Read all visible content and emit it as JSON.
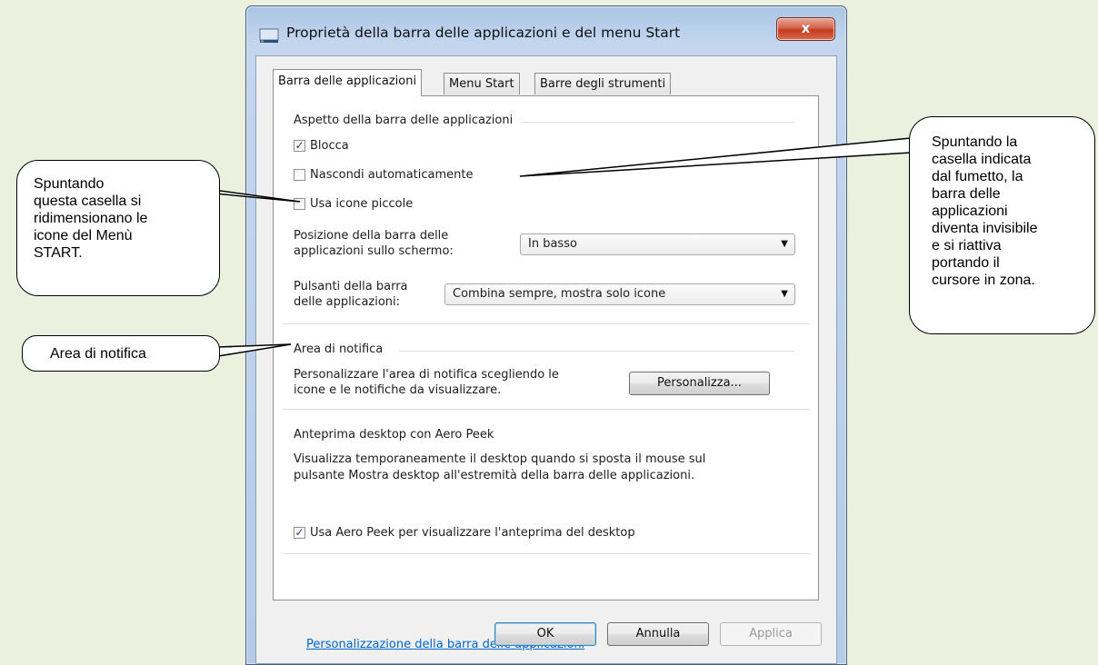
{
  "window": {
    "title": "Proprietà della barra delle applicazioni e del menu Start",
    "close_symbol": "x",
    "tabs": [
      {
        "label": "Barra delle applicazioni",
        "active": true
      },
      {
        "label": "Menu Start",
        "active": false
      },
      {
        "label": "Barre degli strumenti",
        "active": false
      }
    ]
  },
  "appearance": {
    "group_title": "Aspetto della barra delle applicazioni",
    "lock": {
      "label": "Blocca",
      "checked": true
    },
    "autohide": {
      "label": "Nascondi automaticamente",
      "checked": false
    },
    "small_icons": {
      "label": "Usa icone piccole",
      "checked": false
    },
    "position_label_1": "Posizione della barra delle",
    "position_label_2": "applicazioni sullo schermo:",
    "position_value": "In basso",
    "buttons_label_1": "Pulsanti della barra",
    "buttons_label_2": "delle applicazioni:",
    "buttons_value": "Combina sempre, mostra solo icone"
  },
  "notification": {
    "group_title": "Area di notifica",
    "text_1": "Personalizzare l'area di notifica scegliendo le",
    "text_2": "icone e le notifiche da visualizzare.",
    "button": "Personalizza..."
  },
  "aero_peek": {
    "group_title": "Anteprima desktop con Aero Peek",
    "text_1": "Visualizza temporaneamente il desktop quando si sposta il mouse sul",
    "text_2": "pulsante Mostra desktop all'estremità della barra delle applicazioni.",
    "checkbox": {
      "label": "Usa Aero Peek per visualizzare l'anteprima del desktop",
      "checked": true
    }
  },
  "link": "Personalizzazione della barra delle applicazioni",
  "footer": {
    "ok": "OK",
    "cancel": "Annulla",
    "apply": "Applica"
  },
  "check_mark": "✓",
  "dropdown_arrow": "▼",
  "callouts": {
    "small_icons": [
      "Spuntando",
      "questa casella si",
      "ridimensionano le",
      "icone del Menù",
      "START."
    ],
    "notification_area": "Area di notifica",
    "autohide": [
      "Spuntando la",
      "casella indicata",
      "dal fumetto, la",
      "barra delle",
      "applicazioni",
      "diventa invisibile",
      "e si riattiva",
      "portando il",
      "cursore in zona."
    ]
  },
  "colors": {
    "background": "#ebf1de",
    "window_frame": "#b5cbe6",
    "close_button": "#c3391b",
    "link": "#0066cc"
  }
}
